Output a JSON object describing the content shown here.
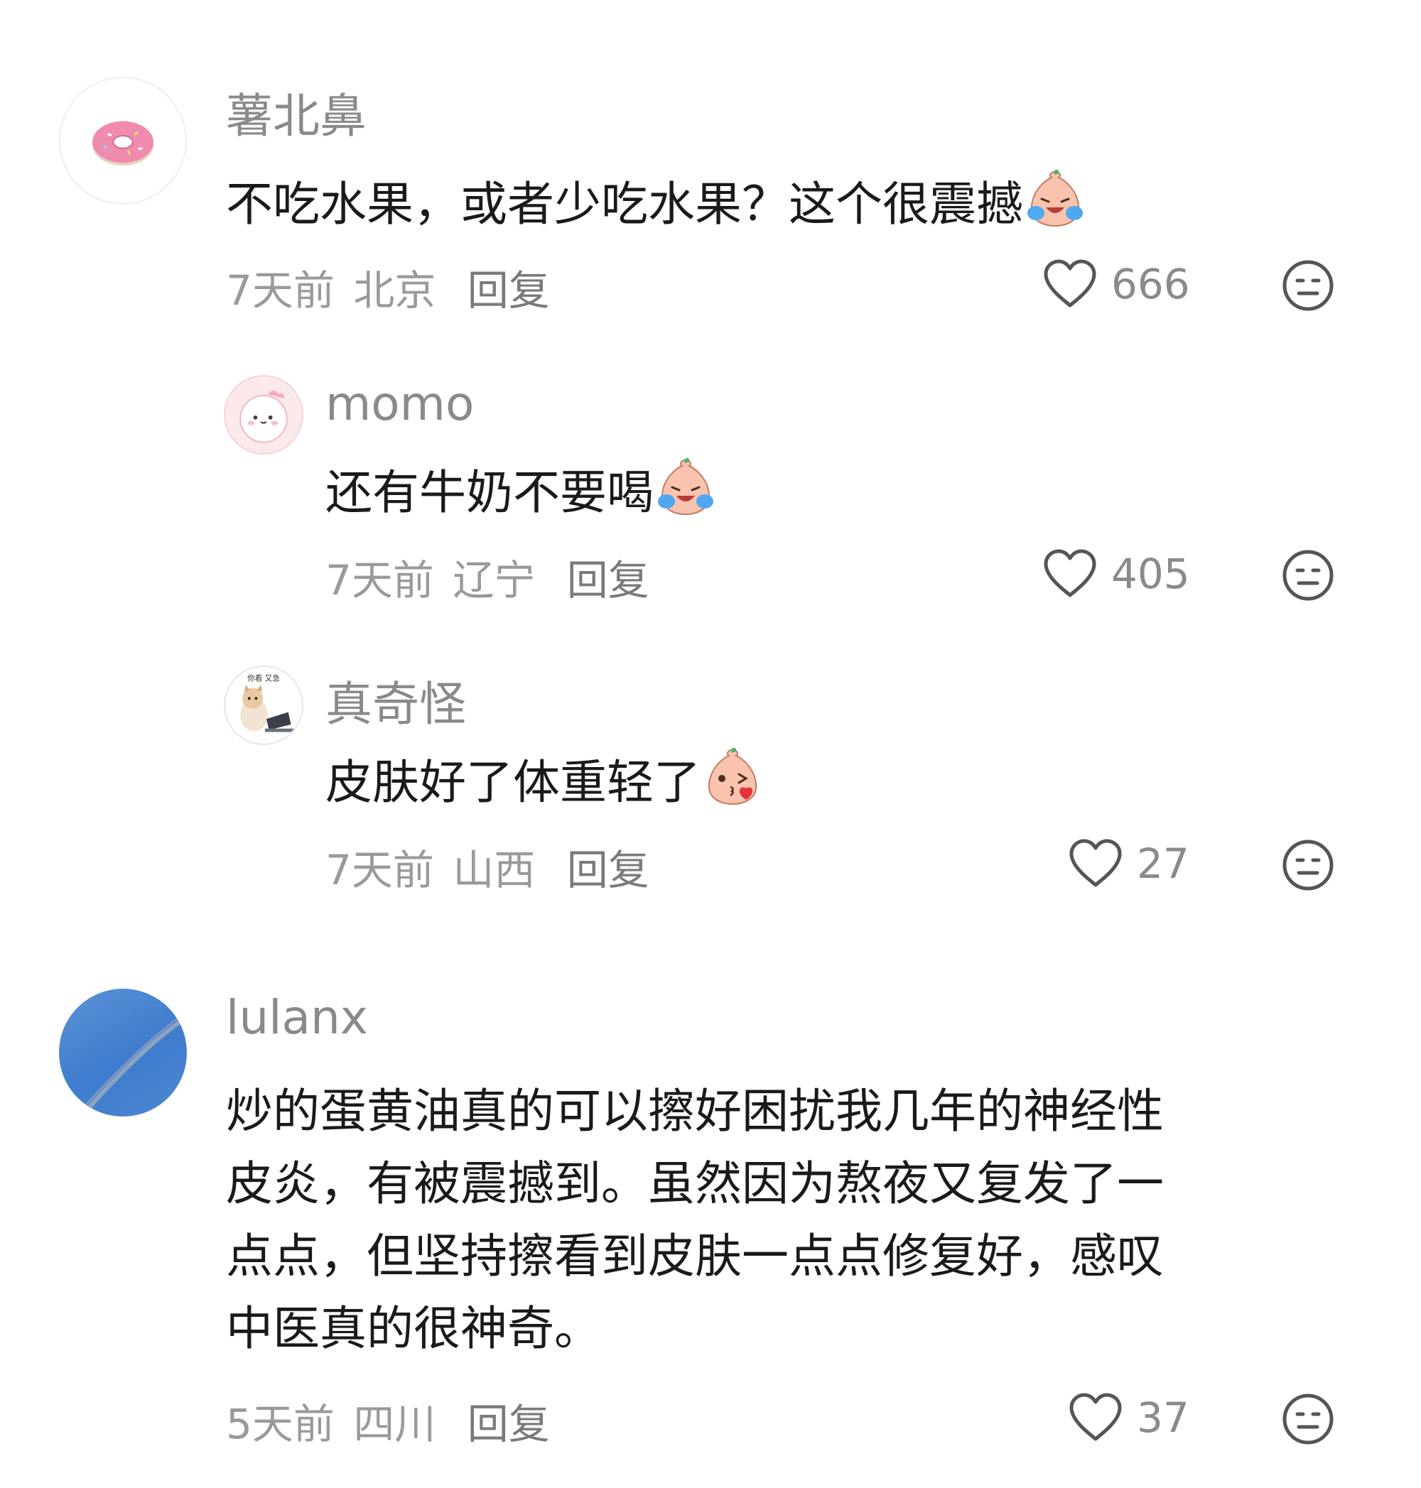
{
  "comments": [
    {
      "username": "薯北鼻",
      "text": "不吃水果，或者少吃水果？这个很震撼",
      "emoji": "crying-laughing-emoji",
      "time": "7天前",
      "location": "北京",
      "reply_label": "回复",
      "likes": "666",
      "avatar": "donut-avatar"
    },
    {
      "username": "momo",
      "text": "还有牛奶不要喝",
      "emoji": "crying-laughing-emoji",
      "time": "7天前",
      "location": "辽宁",
      "reply_label": "回复",
      "likes": "405",
      "avatar": "pink-creature-avatar"
    },
    {
      "username": "真奇怪",
      "text": "皮肤好了体重轻了",
      "emoji": "kiss-emoji",
      "time": "7天前",
      "location": "山西",
      "reply_label": "回复",
      "likes": "27",
      "avatar": "cat-laptop-avatar",
      "avatar_caption": "你看 又急"
    },
    {
      "username": "lulanx",
      "text_lines": [
        "炒的蛋黄油真的可以擦好困扰我几年的神经性",
        "皮炎，有被震撼到。虽然因为熬夜又复发了一",
        "点点，但坚持擦看到皮肤一点点修复好，感叹",
        "中医真的很神奇。"
      ],
      "time": "5天前",
      "location": "四川",
      "reply_label": "回复",
      "likes": "37",
      "avatar": "blue-sky-avatar"
    }
  ],
  "colors": {
    "username": "#8a8a8a",
    "text": "#1a1a1a",
    "meta": "#9a9a9a",
    "icon": "#555555"
  }
}
